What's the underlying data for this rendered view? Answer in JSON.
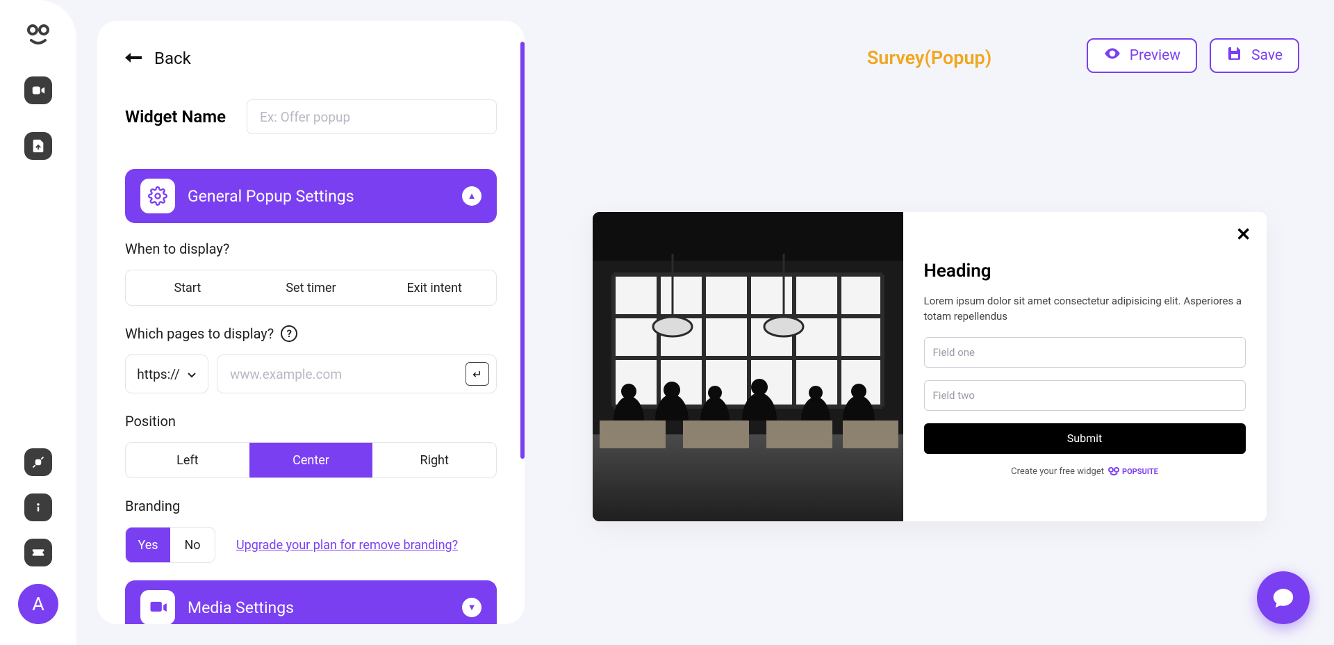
{
  "nav": {
    "avatar_letter": "A"
  },
  "panel": {
    "back_label": "Back",
    "widget_name_label": "Widget Name",
    "widget_name_placeholder": "Ex: Offer popup",
    "section_general": "General Popup Settings",
    "section_media": "Media Settings",
    "when_label": "When to display?",
    "when_options": {
      "start": "Start",
      "timer": "Set timer",
      "exit": "Exit intent"
    },
    "pages_label": "Which pages to display?",
    "protocol": "https://",
    "url_placeholder": "www.example.com",
    "position_label": "Position",
    "position_options": {
      "left": "Left",
      "center": "Center",
      "right": "Right"
    },
    "branding_label": "Branding",
    "yes": "Yes",
    "no": "No",
    "upgrade_text": "Upgrade your plan for remove branding?"
  },
  "top": {
    "title": "Survey(Popup)",
    "preview": "Preview",
    "save": "Save"
  },
  "popup": {
    "heading": "Heading",
    "body": "Lorem ipsum dolor sit amet consectetur adipisicing elit. Asperiores a totam repellendus",
    "field1_placeholder": "Field one",
    "field2_placeholder": "Field two",
    "submit": "Submit",
    "credit_text": "Create your free widget",
    "brand": "POPSUITE"
  }
}
